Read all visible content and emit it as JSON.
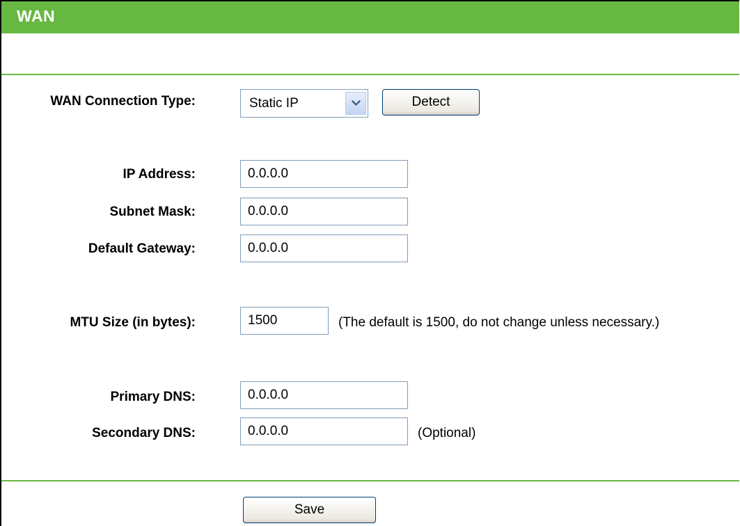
{
  "header": {
    "title": "WAN"
  },
  "connection": {
    "label": "WAN Connection Type:",
    "selected": "Static IP",
    "detect_label": "Detect"
  },
  "ip_address": {
    "label": "IP Address:",
    "value": "0.0.0.0"
  },
  "subnet_mask": {
    "label": "Subnet Mask:",
    "value": "0.0.0.0"
  },
  "default_gateway": {
    "label": "Default Gateway:",
    "value": "0.0.0.0"
  },
  "mtu": {
    "label": "MTU Size (in bytes):",
    "value": "1500",
    "note": "(The default is 1500, do not change unless necessary.)"
  },
  "primary_dns": {
    "label": "Primary DNS:",
    "value": "0.0.0.0"
  },
  "secondary_dns": {
    "label": "Secondary DNS:",
    "value": "0.0.0.0",
    "note": "(Optional)"
  },
  "actions": {
    "save_label": "Save"
  },
  "colors": {
    "header_green": "#67b843",
    "input_border": "#7f9db9"
  },
  "icons": {
    "select_arrow": "chevron-down-icon"
  }
}
